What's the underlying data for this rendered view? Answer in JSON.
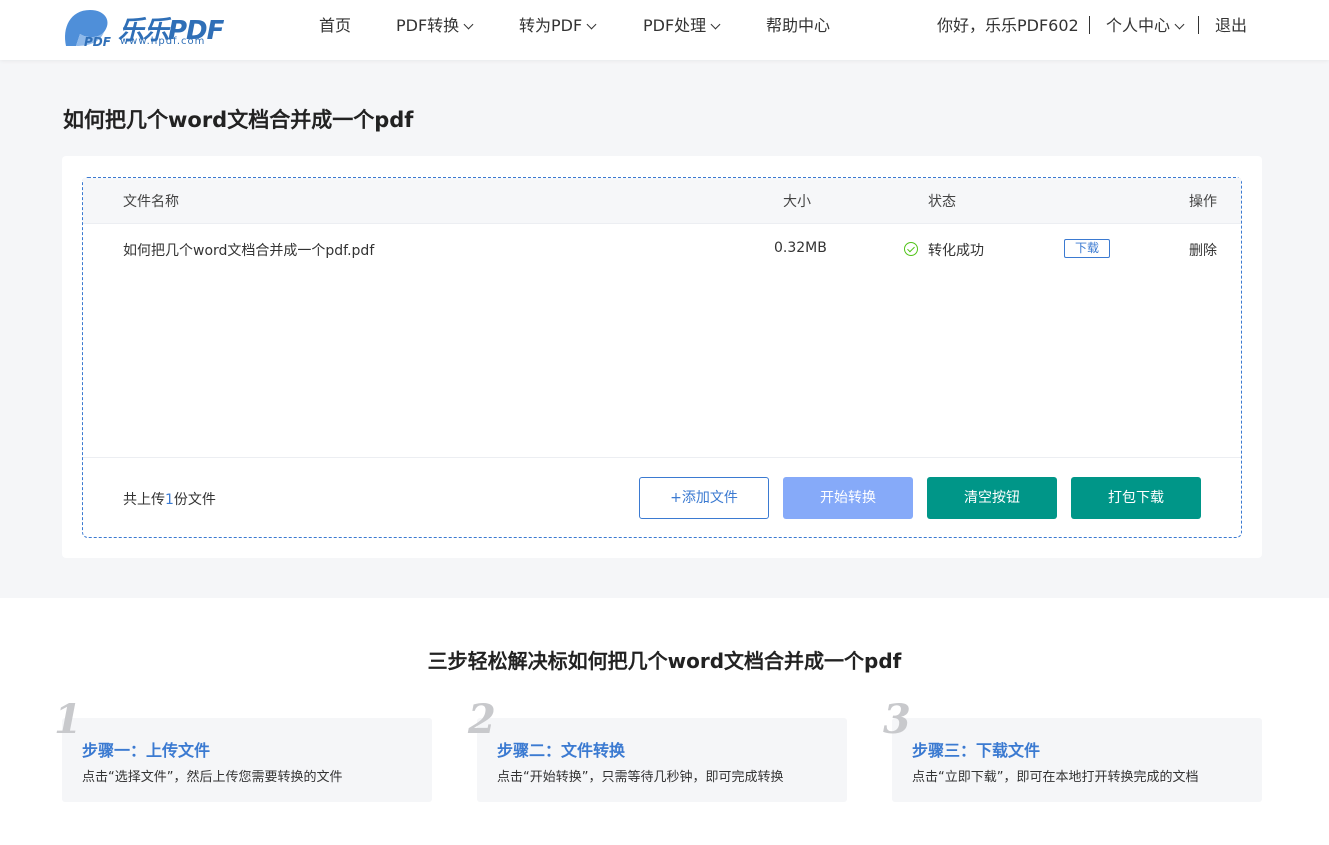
{
  "header": {
    "logo_text": "乐乐PDF",
    "logo_sub": "www.llpdf.com",
    "nav": [
      {
        "label": "首页",
        "has_dropdown": false
      },
      {
        "label": "PDF转换",
        "has_dropdown": true
      },
      {
        "label": "转为PDF",
        "has_dropdown": true
      },
      {
        "label": "PDF处理",
        "has_dropdown": true
      },
      {
        "label": "帮助中心",
        "has_dropdown": false
      }
    ],
    "greeting": "你好，乐乐PDF602",
    "user_center": "个人中心",
    "logout": "退出"
  },
  "page_title": "如何把几个word文档合并成一个pdf",
  "table": {
    "headers": {
      "name": "文件名称",
      "size": "大小",
      "status": "状态",
      "action": "操作"
    },
    "rows": [
      {
        "name": "如何把几个word文档合并成一个pdf.pdf",
        "size": "0.32MB",
        "status": "转化成功",
        "download": "下载",
        "delete": "删除"
      }
    ]
  },
  "footer": {
    "count_prefix": "共上传",
    "count": "1",
    "count_suffix": "份文件",
    "add_label": "+添加文件",
    "start_label": "开始转换",
    "clear_label": "清空按钮",
    "pack_label": "打包下载"
  },
  "steps_title": "三步轻松解决标如何把几个word文档合并成一个pdf",
  "steps": [
    {
      "num": "1",
      "title": "步骤一：上传文件",
      "desc": "点击“选择文件”，然后上传您需要转换的文件"
    },
    {
      "num": "2",
      "title": "步骤二：文件转换",
      "desc": "点击“开始转换”，只需等待几秒钟，即可完成转换"
    },
    {
      "num": "3",
      "title": "步骤三：下载文件",
      "desc": "点击“立即下载”，即可在本地打开转换完成的文档"
    }
  ],
  "colors": {
    "accent": "#3b7ad1",
    "teal": "#009688",
    "start_disabled": "#86aaf9",
    "success": "#52c41a"
  }
}
